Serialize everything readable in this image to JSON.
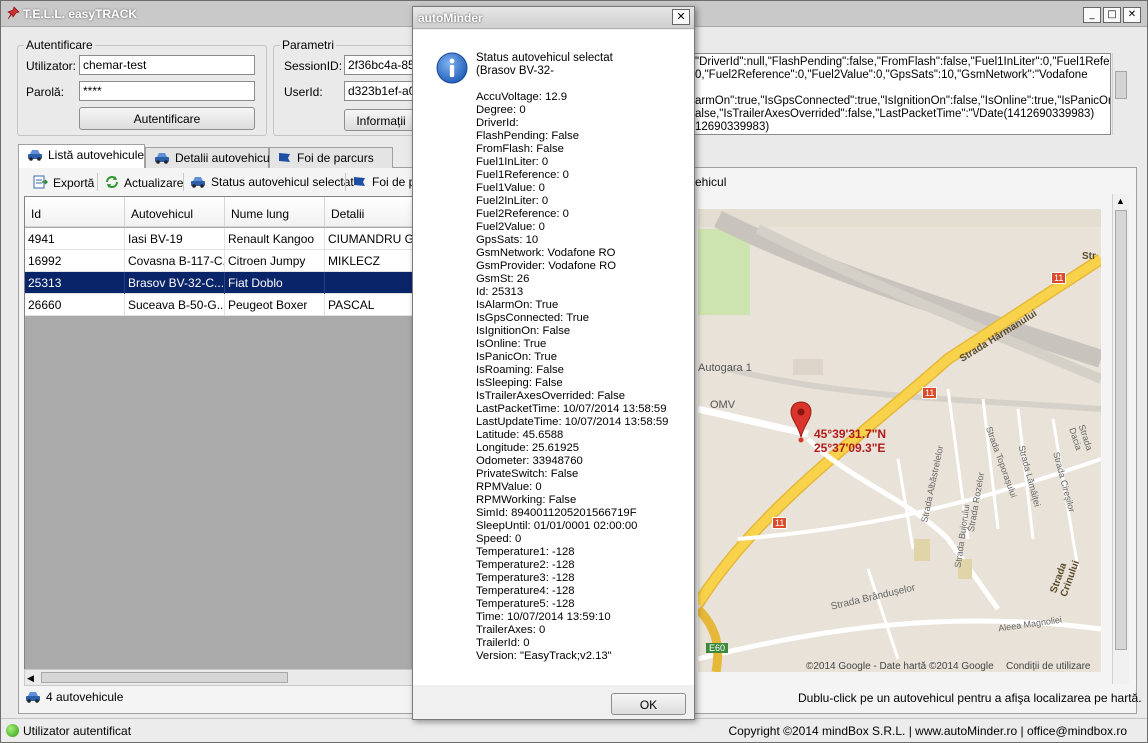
{
  "app": {
    "title": "T.E.L.L. easyTRACK"
  },
  "auth": {
    "legend": "Autentificare",
    "user_label": "Utilizator:",
    "user_value": "chemar-test",
    "pass_label": "Parolă:",
    "pass_value": "****",
    "login_button": "Autentificare"
  },
  "params": {
    "legend": "Parametri",
    "session_label": "SessionID:",
    "session_value": "2f36bc4a-853",
    "user_label": "UserId:",
    "user_value": "d323b1ef-a0e",
    "info_button": "Informații"
  },
  "json_lines": [
    "\"DriverId\":null,\"FlashPending\":false,\"FromFlash\":false,\"Fuel1InLiter\":0,\"Fuel1Reference",
    "0,\"Fuel2Reference\":0,\"Fuel2Value\":0,\"GpsSats\":10,\"GsmNetwork\":\"Vodafone",
    "",
    "armOn\":true,\"IsGpsConnected\":true,\"IsIgnitionOn\":false,\"IsOnline\":true,\"IsPanicOn\":tru",
    "alse,\"IsTrailerAxesOverrided\":false,\"LastPacketTime\":\"\\/Date(1412690339983)",
    "12690339983)"
  ],
  "tabs": [
    {
      "label": "Listă autovehicule"
    },
    {
      "label": "Detalii autovehicule"
    },
    {
      "label": "Foi de parcurs"
    }
  ],
  "toolbar": {
    "export": "Exportă",
    "refresh": "Actualizare",
    "status": "Status autovehicul selectat",
    "sheets": "Foi de pa",
    "map_fragment": "ehicul"
  },
  "table": {
    "columns": [
      "Id",
      "Autovehicul",
      "Nume lung",
      "Detalii"
    ],
    "rows": [
      {
        "id": "4941",
        "vehicle": "Iasi BV-19",
        "name": "Renault Kangoo",
        "details": "CIUMANDRU G..."
      },
      {
        "id": "16992",
        "vehicle": "Covasna B-117-C...",
        "name": "Citroen Jumpy",
        "details": "MIKLECZ"
      },
      {
        "id": "25313",
        "vehicle": "Brasov BV-32-C...",
        "name": "Fiat Doblo",
        "details": ""
      },
      {
        "id": "26660",
        "vehicle": "Suceava B-50-G...",
        "name": "Peugeot Boxer",
        "details": "PASCAL"
      }
    ],
    "selected_row": 2
  },
  "footer": {
    "vehicle_count": "4 autovehicule",
    "hint": "Dublu-click pe un autovehicul pentru a afişa localizarea pe hartă."
  },
  "map": {
    "coords_lat": "45°39'31.7\"N",
    "coords_lon": "25°37'09.3\"E",
    "labels": {
      "autogara": "Autogara 1",
      "omv": "OMV",
      "harmanului": "Strada Hărmanului",
      "brandus": "Strada Brândușelor",
      "toporasului": "Strada Toporașului",
      "lamaitei": "Strada Lămâiței",
      "albastrelelor": "Strada Albăstrelelor",
      "rozelor": "Strada Rozelor",
      "bujorului": "Strada Bujorului",
      "dacia": "Strada Dacia",
      "ciresilor": "Strada Cireșilor",
      "crinului": "Strada Crinului",
      "magnoliei": "Aleea Magnoliei",
      "e60": "E60",
      "road_11": "11",
      "copyright": "©2014 Google - Date hartă ©2014 Google",
      "terms": "Condiții de utilizare",
      "str_fragment": "Str"
    }
  },
  "statusbar": {
    "left": "Utilizator autentificat",
    "right": "Copyright ©2014 mindBox S.R.L. | www.autoMinder.ro | office@mindbox.ro"
  },
  "dialog": {
    "title": "autoMinder",
    "heading1": "Status autovehicul selectat",
    "heading2": "(Brasov BV-32-",
    "lines": [
      "AccuVoltage: 12.9",
      "Degree: 0",
      "DriverId:",
      "FlashPending: False",
      "FromFlash: False",
      "Fuel1InLiter: 0",
      "Fuel1Reference: 0",
      "Fuel1Value: 0",
      "Fuel2InLiter: 0",
      "Fuel2Reference: 0",
      "Fuel2Value: 0",
      "GpsSats: 10",
      "GsmNetwork: Vodafone RO",
      "GsmProvider: Vodafone RO",
      "GsmSt: 26",
      "Id: 25313",
      "IsAlarmOn: True",
      "IsGpsConnected: True",
      "IsIgnitionOn: False",
      "IsOnline: True",
      "IsPanicOn: True",
      "IsRoaming: False",
      "IsSleeping: False",
      "IsTrailerAxesOverrided: False",
      "LastPacketTime: 10/07/2014 13:58:59",
      "LastUpdateTime: 10/07/2014 13:58:59",
      "Latitude: 45.6588",
      "Longitude: 25.61925",
      "Odometer: 33948760",
      "PrivateSwitch: False",
      "RPMValue: 0",
      "RPMWorking: False",
      "SimId: 8940011205201566719F",
      "SleepUntil: 01/01/0001 02:00:00",
      "Speed: 0",
      "Temperature1: -128",
      "Temperature2: -128",
      "Temperature3: -128",
      "Temperature4: -128",
      "Temperature5: -128",
      "Time: 10/07/2014 13:59:10",
      "TrailerAxes: 0",
      "TrailerId: 0",
      "Version: \"EasyTrack;v2.13\""
    ],
    "ok": "OK"
  },
  "colors": {
    "selected_row": "#0a246a",
    "info_icon": "#1e5bb8",
    "map_pin": "#d9342b",
    "coord_text": "#b11a1a",
    "road_major": "#f7d24a"
  }
}
